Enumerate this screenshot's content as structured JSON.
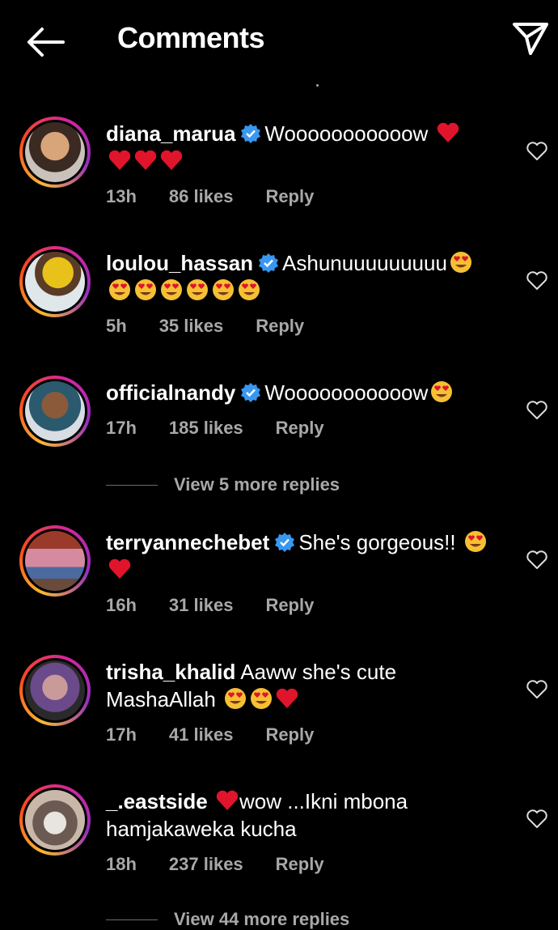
{
  "header": {
    "title": "Comments"
  },
  "comments": [
    {
      "username": "diana_marua",
      "verified": true,
      "text": "Wooooooooooow",
      "emoji": [
        "heart",
        "heart",
        "heart",
        "heart"
      ],
      "time": "13h",
      "likes": "86 likes",
      "reply": "Reply"
    },
    {
      "username": "loulou_hassan",
      "verified": true,
      "text": "Ashunuuuuuuuuu",
      "emoji": [
        "heart-eyes",
        "heart-eyes",
        "heart-eyes",
        "heart-eyes",
        "heart-eyes",
        "heart-eyes",
        "heart-eyes"
      ],
      "time": "5h",
      "likes": "35 likes",
      "reply": "Reply"
    },
    {
      "username": "officialnandy",
      "verified": true,
      "text": "Wooooooooooow",
      "emoji": [
        "heart-eyes"
      ],
      "time": "17h",
      "likes": "185 likes",
      "reply": "Reply",
      "view_more": "View 5 more replies"
    },
    {
      "username": "terryannechebet",
      "verified": true,
      "text": "She's gorgeous!!",
      "emoji": [
        "heart-eyes",
        "heart"
      ],
      "time": "16h",
      "likes": "31 likes",
      "reply": "Reply"
    },
    {
      "username": "trisha_khalid",
      "verified": false,
      "text": "Aaww she's cute MashaAllah",
      "emoji": [
        "heart-eyes",
        "heart-eyes",
        "heart"
      ],
      "time": "17h",
      "likes": "41 likes",
      "reply": "Reply"
    },
    {
      "username": "_.eastside",
      "verified": false,
      "text_before": "",
      "text": "wow ...Ikni mbona hamjakaweka kucha",
      "emoji": [
        "heart"
      ],
      "time": "18h",
      "likes": "237 likes",
      "reply": "Reply",
      "view_more": "View 44 more replies"
    }
  ],
  "colors": {
    "background": "#000000",
    "meta": "#a8a8a8",
    "verified": "#3897f0",
    "heart": "#e0142b"
  }
}
